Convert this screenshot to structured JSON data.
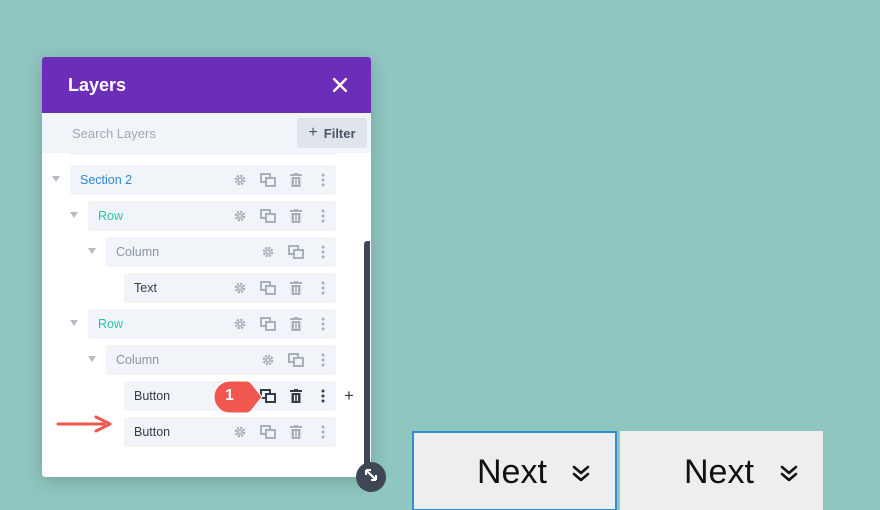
{
  "layers_panel": {
    "title": "Layers",
    "close_icon": "close-icon",
    "search": {
      "placeholder": "Search Layers",
      "value": ""
    },
    "filter": {
      "label": "Filter",
      "icon": "plus-icon"
    },
    "items": [
      {
        "label": "Section 2",
        "type": "section"
      },
      {
        "label": "Row",
        "type": "row"
      },
      {
        "label": "Column",
        "type": "column"
      },
      {
        "label": "Text",
        "type": "module"
      },
      {
        "label": "Row",
        "type": "row"
      },
      {
        "label": "Column",
        "type": "column"
      },
      {
        "label": "Button",
        "type": "module",
        "highlighted": true
      },
      {
        "label": "Button",
        "type": "module"
      }
    ],
    "action_icons": [
      "gear-icon",
      "duplicate-icon",
      "trash-icon",
      "more-vertical-icon"
    ],
    "callout_badge": "1",
    "add_icon": "+"
  },
  "canvas": {
    "buttons": [
      {
        "label": "Next",
        "icon": "double-chevron-down-icon",
        "selected": true
      },
      {
        "label": "Next",
        "icon": "double-chevron-down-icon",
        "selected": false
      }
    ]
  },
  "colors": {
    "background": "#8fc6bf",
    "panel_header": "#6c2eb9",
    "section_label": "#2b87da",
    "row_label": "#29c4a9",
    "column_label": "#8c95a3",
    "callout": "#f0574f",
    "selection_border": "#2f8fd6"
  }
}
